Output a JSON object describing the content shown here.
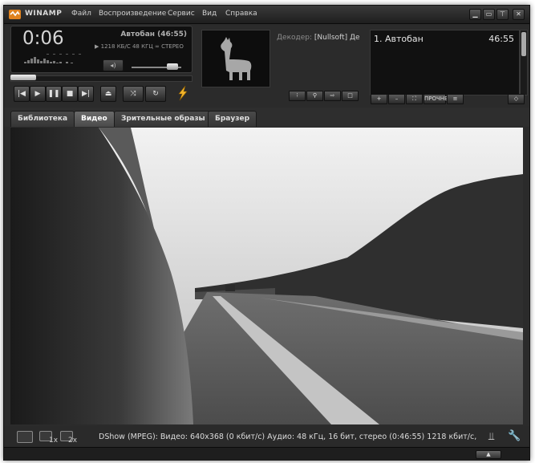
{
  "titlebar": {
    "app_title": "WINAMP",
    "menu": [
      "Файл",
      "Воспроизведение",
      "Сервис",
      "Вид",
      "Справка"
    ],
    "window_buttons": [
      "minimize",
      "restore",
      "shade",
      "close"
    ]
  },
  "player": {
    "time": "0:06",
    "track_title": "Автобан (46:55)",
    "bitrate": "1218",
    "bitrate_unit": "КБ/С",
    "samplerate": "48",
    "samplerate_unit": "КГЦ",
    "channels": "СТЕРЕО",
    "seek_fraction": 0.0022,
    "volume_fraction": 0.75
  },
  "art": {
    "decoder_label": "Декодер:",
    "decoder_value": "[Nullsoft] Де"
  },
  "playlist": {
    "items": [
      {
        "name": "1. Автобан",
        "duration": "46:55"
      }
    ],
    "buttons": [
      "+",
      "–",
      "⛶",
      "ПРОЧНЕЕ",
      "≡",
      "◇"
    ]
  },
  "tabs": [
    {
      "label": "Библиотека",
      "active": false
    },
    {
      "label": "Видео",
      "active": true
    },
    {
      "label": "Зрительные образы",
      "active": false
    },
    {
      "label": "Браузер",
      "active": false
    }
  ],
  "status": {
    "text": "DShow (MPEG): Видео: 640x368 (0 кбит/с) Аудио: 48 кГц, 16 бит, стерео (0:46:55) 1218 кбит/с,",
    "zoom_1x": "1x",
    "zoom_2x": "2x"
  },
  "colors": {
    "frame": "#2b2b2b",
    "accent": "#d4d4d4",
    "active_tab": "#5a5a5a"
  }
}
